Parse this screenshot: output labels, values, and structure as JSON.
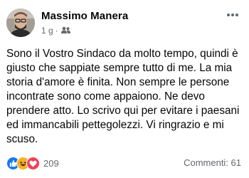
{
  "post": {
    "author": "Massimo Manera",
    "time": "1 g",
    "audience_icon": "friends-icon",
    "body": "Sono il Vostro Sindaco da molto tempo, quindi è giusto che sappiate sempre tutto di me. La mia storia d'amore è finita. Non sempre le persone incontrate sono come appaiono. Ne devo prendere atto. Lo scrivo qui per evitare i paesani ed immancabili pettegolezzi. Vi ringrazio e mi scuso.",
    "reactions": {
      "icons": [
        "like-icon",
        "haha-icon",
        "love-icon"
      ],
      "count": "209"
    },
    "comments": "Commenti: 61"
  },
  "colors": {
    "like": "#1877f2",
    "haha": "#f7b125",
    "love": "#f33e58",
    "secondary_text": "#65676b"
  }
}
